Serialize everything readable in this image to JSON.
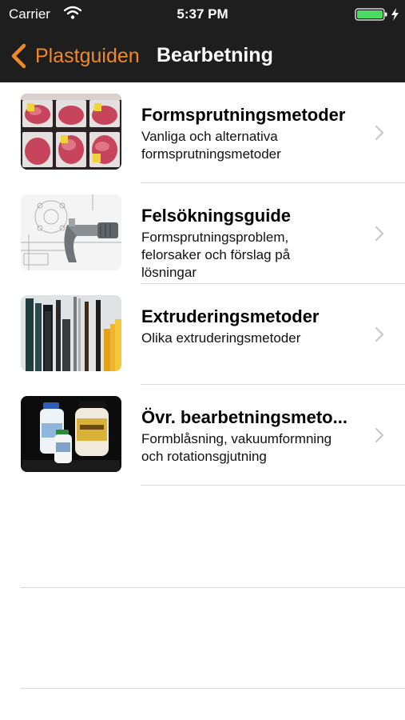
{
  "status_bar": {
    "carrier": "Carrier",
    "time": "5:37 PM",
    "wifi_icon": "wifi-icon",
    "battery_icon": "battery-charging-icon",
    "battery_color": "#4cd964"
  },
  "navbar": {
    "back_label": "Plastguiden",
    "title": "Bearbetning",
    "accent_color": "#f08a24",
    "background_color": "#1e1e1e"
  },
  "items": [
    {
      "title": "Formsprutningsmetoder",
      "subtitle_lines": [
        "Vanliga och alternativa",
        "formsprutningsmetoder"
      ],
      "image": "meat-trays-image"
    },
    {
      "title": "Felsökningsguide",
      "subtitle_lines": [
        "Formsprutningsproblem,",
        "felorsaker och förslag på",
        "lösningar"
      ],
      "image": "micrometer-image"
    },
    {
      "title": "Extruderingsmetoder",
      "subtitle_lines": [
        "Olika extruderingsmetoder"
      ],
      "image": "extruded-profiles-image"
    },
    {
      "title": "Övr. bearbetningsmeto...",
      "subtitle_lines": [
        "Formblåsning, vakuumformning",
        "och rotationsgjutning"
      ],
      "image": "plastic-bottles-image"
    }
  ]
}
